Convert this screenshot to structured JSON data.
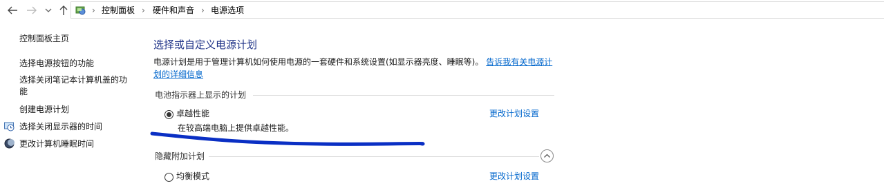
{
  "address_bar": {
    "back_icon": "back-arrow-icon",
    "forward_icon": "forward-arrow-icon",
    "recent_icon": "chevron-down-icon",
    "up_icon": "up-arrow-icon",
    "location_icon": "control-panel-icon",
    "breadcrumbs": [
      "控制面板",
      "硬件和声音",
      "电源选项"
    ],
    "separator": "›"
  },
  "sidebar": {
    "home_label": "控制面板主页",
    "items": [
      {
        "label": "选择电源按钮的功能"
      },
      {
        "label": "选择关闭笔记本计算机盖的功能"
      },
      {
        "label": "创建电源计划"
      },
      {
        "label": "选择关闭显示器的时间",
        "icon": "display-clock-icon"
      },
      {
        "label": "更改计算机睡眠时间",
        "icon": "moon-icon"
      }
    ]
  },
  "main": {
    "title": "选择或自定义电源计划",
    "description": "电源计划是用于管理计算机如何使用电源的一套硬件和系统设置(如显示器亮度、睡眠等)。",
    "description_link": "告诉我有关电源计划的详细信息",
    "battery_group": {
      "heading": "电池指示器上显示的计划",
      "plans": [
        {
          "name": "卓越性能",
          "selected": true,
          "description": "在较高端电脑上提供卓越性能。",
          "link": "更改计划设置"
        }
      ]
    },
    "hidden_group": {
      "heading": "隐藏附加计划",
      "collapse_icon": "chevron-up-icon",
      "plans": [
        {
          "name": "均衡模式",
          "selected": false,
          "link": "更改计划设置"
        }
      ]
    }
  },
  "colors": {
    "title": "#1e3287",
    "link": "#0066cc",
    "annotation_stroke": "#0a2fc4"
  }
}
